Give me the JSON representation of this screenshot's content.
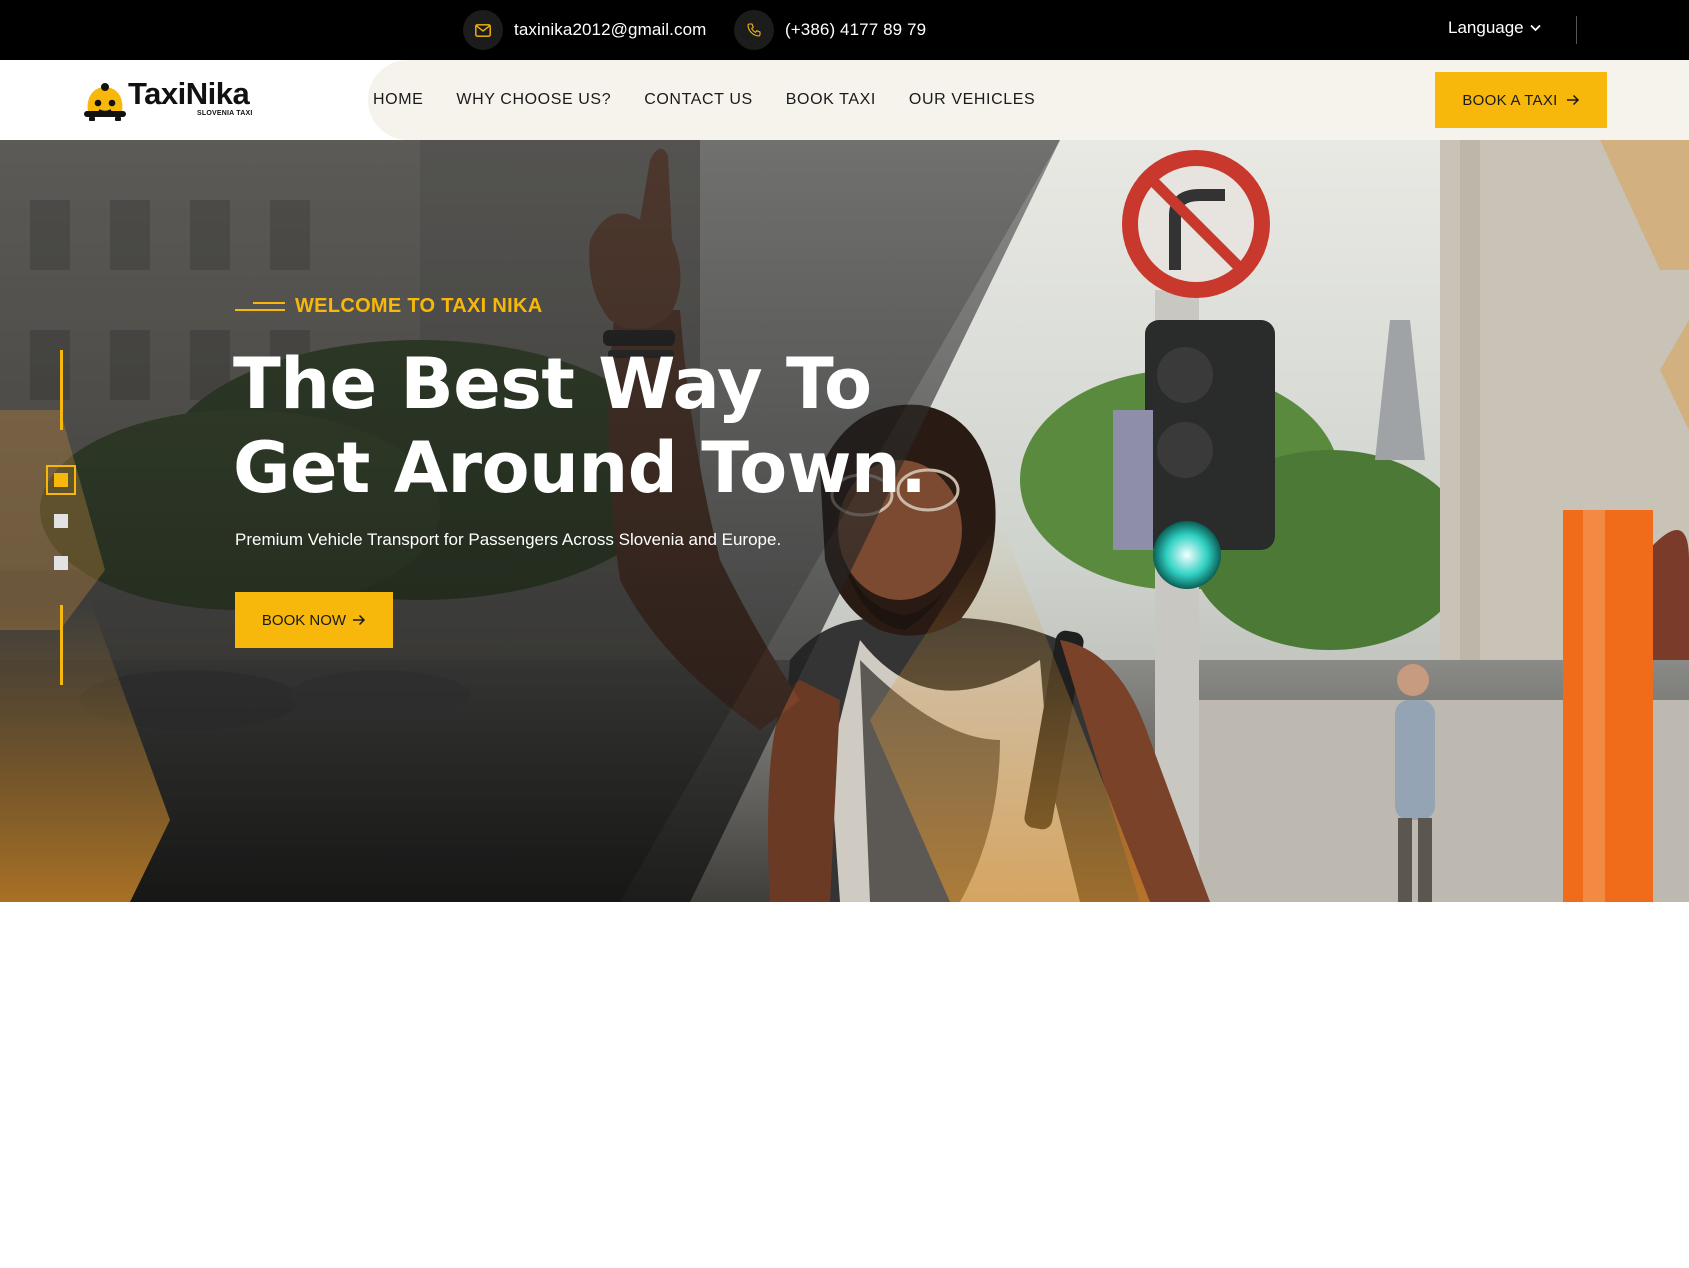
{
  "topbar": {
    "email": "taxinika2012@gmail.com",
    "phone": "(+386) 4177 89 79",
    "language_label": "Language"
  },
  "header": {
    "logo_text": "TaxiNika",
    "logo_subtext": "SLOVENIA TAXI",
    "nav": [
      "HOME",
      "WHY CHOOSE US?",
      "CONTACT US",
      "BOOK TAXI",
      "OUR VEHICLES"
    ],
    "cta_label": "BOOK A TAXI"
  },
  "hero": {
    "eyebrow": "WELCOME TO TAXI NIKA",
    "headline_line1": "The Best Way To",
    "headline_line2": "Get Around Town.",
    "subtitle": "Premium Vehicle Transport for Passengers Across Slovenia and Europe.",
    "cta_label": "BOOK NOW",
    "slides_total": 3,
    "active_slide": 1
  },
  "colors": {
    "accent": "#f7b80b",
    "topbar_bg": "#000000",
    "nav_bg": "#f6f3ec"
  },
  "icons": [
    "envelope-icon",
    "phone-icon",
    "chevron-down-icon",
    "arrow-right-icon",
    "taxi-logo-icon"
  ]
}
